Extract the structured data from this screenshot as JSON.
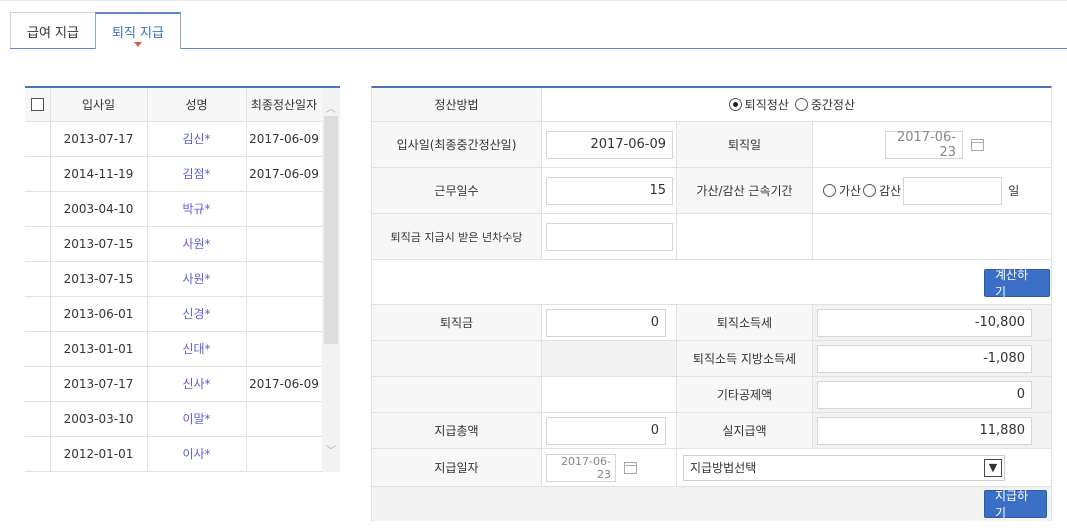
{
  "tabs": [
    {
      "label": "급여 지급",
      "active": false
    },
    {
      "label": "퇴직 지급",
      "active": true
    }
  ],
  "list": {
    "headers": [
      "",
      "입사일",
      "성명",
      "최종정산일자"
    ],
    "rows": [
      {
        "join": "2013-07-17",
        "name": "김신*",
        "last": "2017-06-09"
      },
      {
        "join": "2014-11-19",
        "name": "김점*",
        "last": "2017-06-09"
      },
      {
        "join": "2003-04-10",
        "name": "박규*",
        "last": ""
      },
      {
        "join": "2013-07-15",
        "name": "사원*",
        "last": ""
      },
      {
        "join": "2013-07-15",
        "name": "사원*",
        "last": ""
      },
      {
        "join": "2013-06-01",
        "name": "신경*",
        "last": ""
      },
      {
        "join": "2013-01-01",
        "name": "신대*",
        "last": ""
      },
      {
        "join": "2013-07-17",
        "name": "신사*",
        "last": "2017-06-09"
      },
      {
        "join": "2003-03-10",
        "name": "이말*",
        "last": ""
      },
      {
        "join": "2012-01-01",
        "name": "이사*",
        "last": ""
      }
    ]
  },
  "form": {
    "method_label": "정산방법",
    "method_opt1": "퇴직정산",
    "method_opt2": "중간정산",
    "join_label": "입사일(최종중간정산일)",
    "join_value": "2017-06-09",
    "retire_label": "퇴직일",
    "retire_value": "2017-06-23",
    "workdays_label": "근무일수",
    "workdays_value": "15",
    "adjust_label": "가산/감산 근속기간",
    "adjust_opt1": "가산",
    "adjust_opt2": "감산",
    "adjust_unit": "일",
    "annual_label": "퇴직금 지급시 받은 년차수당",
    "calc_button": "계산하기",
    "severance_label": "퇴직금",
    "severance_value": "0",
    "income_tax_label": "퇴직소득세",
    "income_tax_value": "-10,800",
    "local_tax_label": "퇴직소득 지방소득세",
    "local_tax_value": "-1,080",
    "other_label": "기타공제액",
    "other_value": "0",
    "total_label": "지급총액",
    "total_value": "0",
    "net_label": "실지급액",
    "net_value": "11,880",
    "paydate_label": "지급일자",
    "paydate_value": "2017-06-23",
    "paymethod_value": "지급방법선택",
    "pay_button": "지급하기"
  },
  "colors": {
    "accent": "#3b6ec5",
    "name_text": "#5b5fd2",
    "caret": "#e05a4a"
  }
}
